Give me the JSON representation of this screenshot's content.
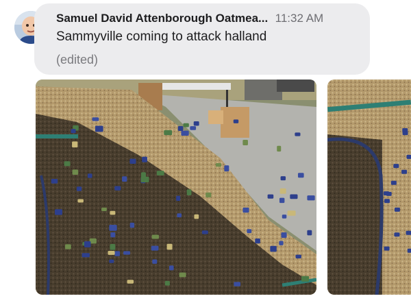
{
  "message": {
    "sender": "Samuel David Attenborough Oatmea...",
    "time": "11:32 AM",
    "text": "Sammyville coming to attack halland",
    "edited": "(edited)"
  },
  "attachments": [
    {
      "type": "photo",
      "subject": "toy army men on wood mulch"
    },
    {
      "type": "photo",
      "subject": "toy army men on wood mulch (partial)"
    }
  ],
  "colors": {
    "bubble": "#ececee",
    "sender": "#1d1d1f",
    "time": "#6e6e73",
    "edited": "#7a7a7e"
  }
}
